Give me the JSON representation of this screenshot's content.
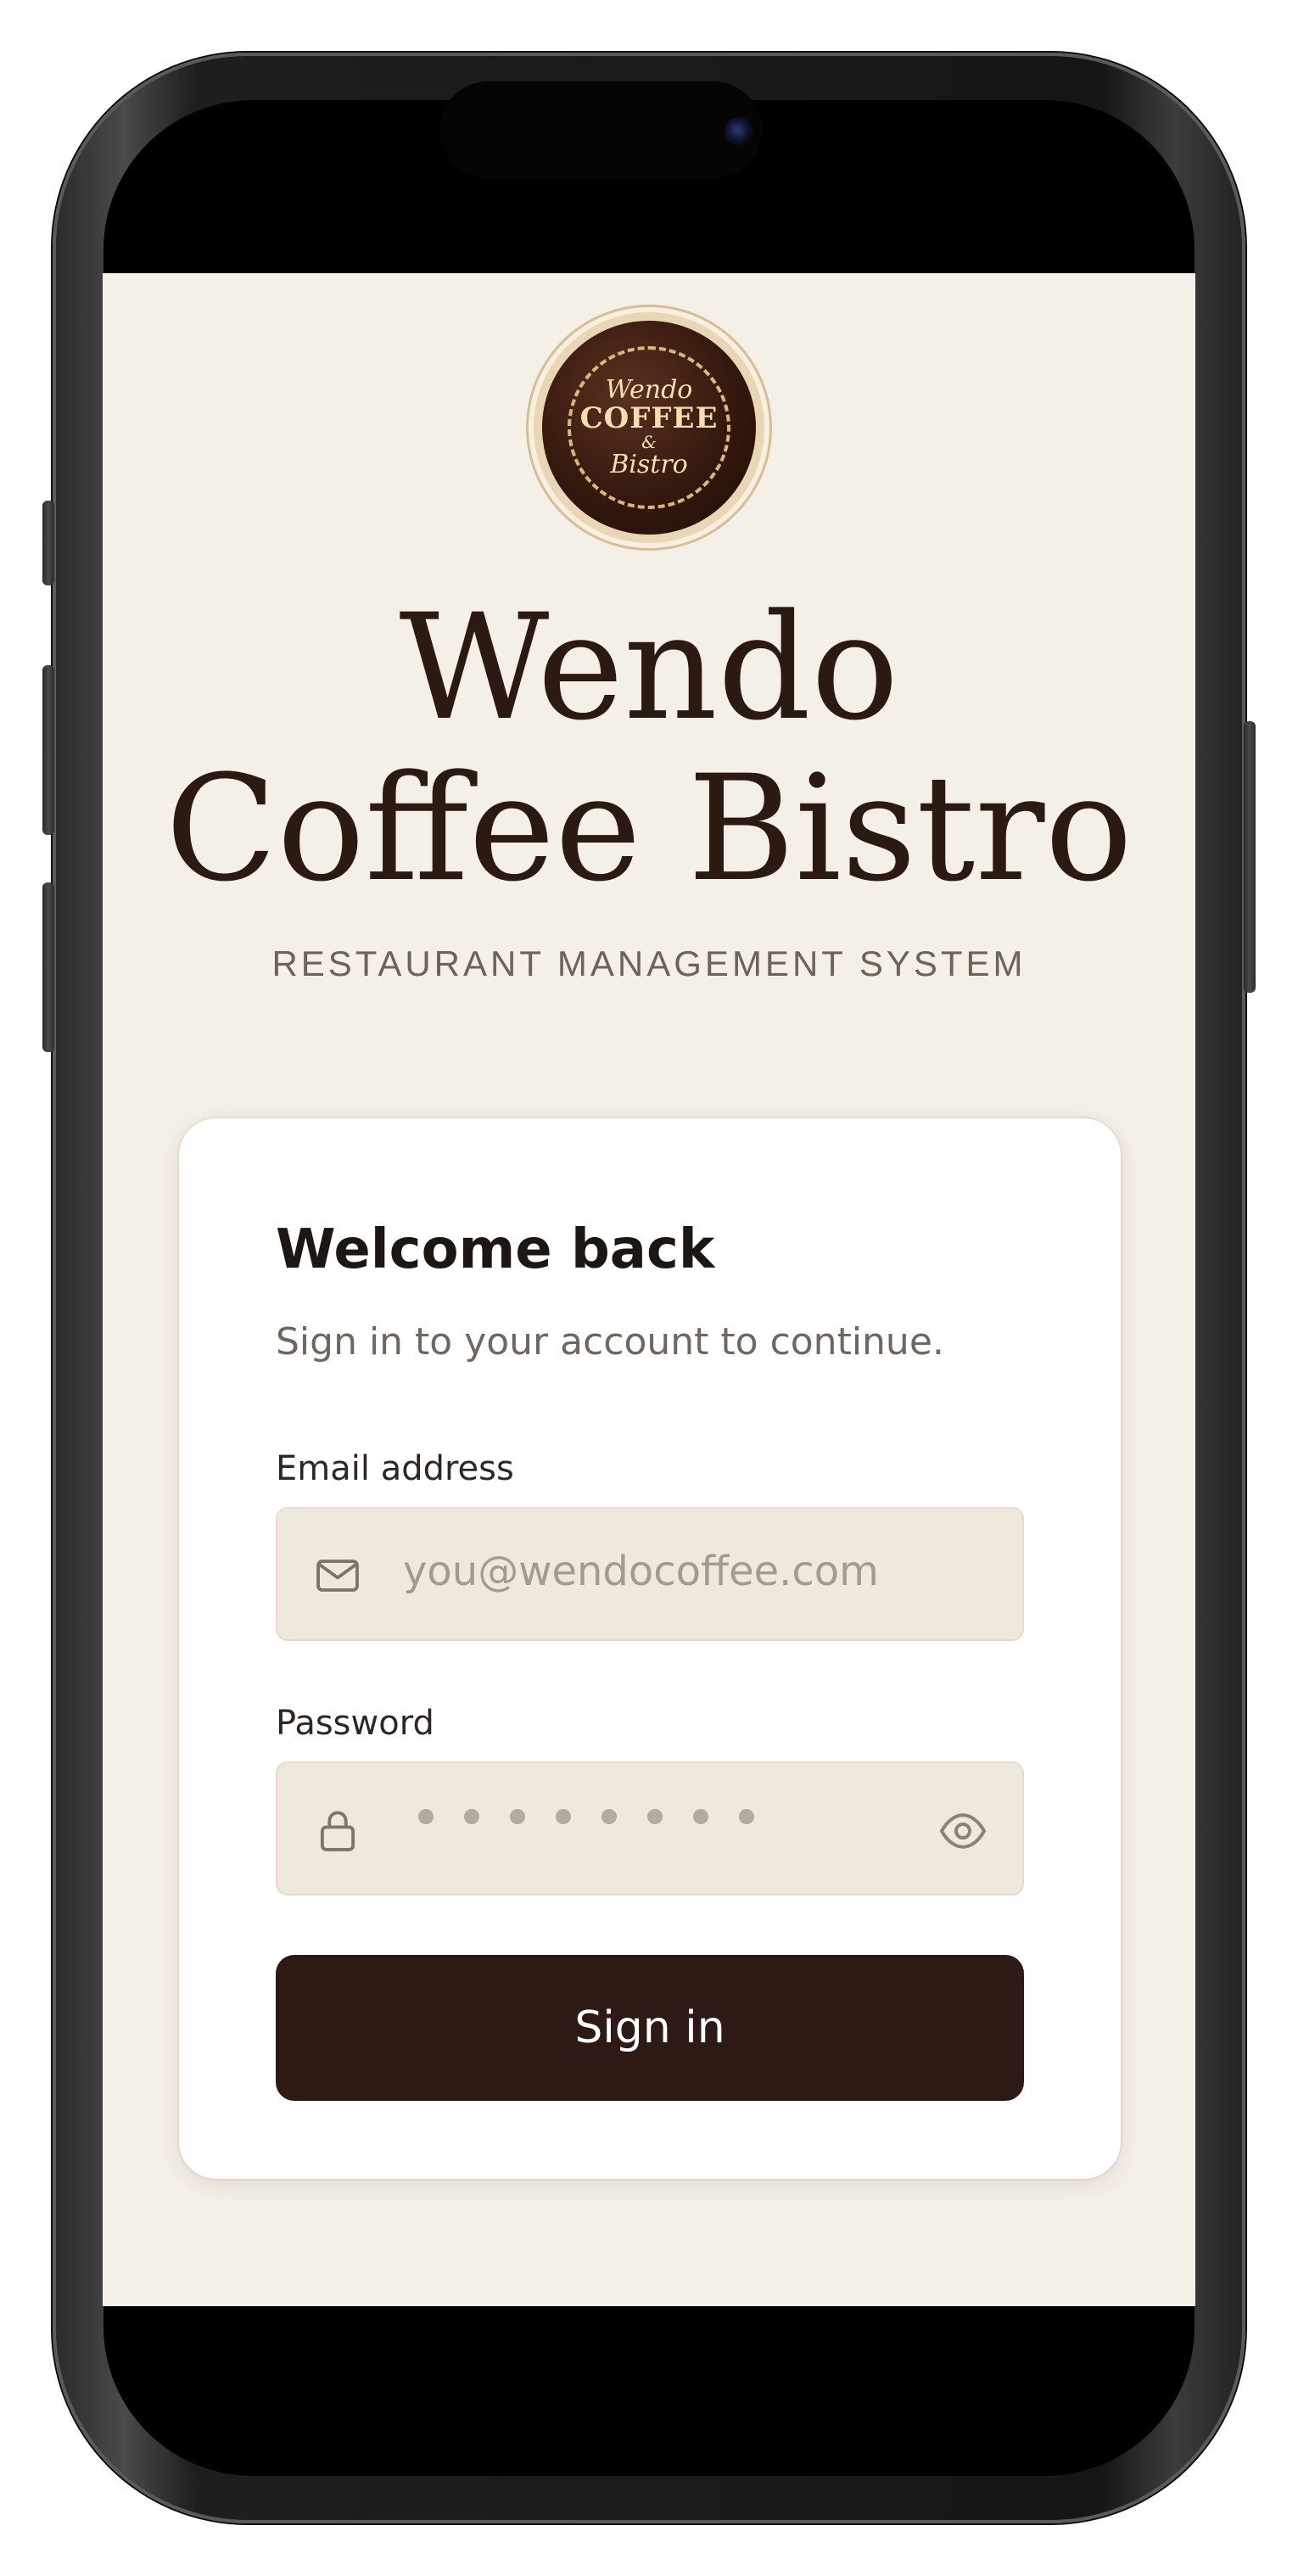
{
  "logo": {
    "line1": "Wendo",
    "line2": "COFFEE",
    "line3": "&",
    "line4": "Bistro"
  },
  "brand": {
    "title_line1": "Wendo",
    "title_line2": "Coffee Bistro",
    "subtitle": "RESTAURANT MANAGEMENT SYSTEM"
  },
  "login": {
    "heading": "Welcome back",
    "subheading": "Sign in to your account to continue.",
    "email": {
      "label": "Email address",
      "placeholder": "you@wendocoffee.com",
      "icon": "mail-icon"
    },
    "password": {
      "label": "Password",
      "icon": "lock-icon",
      "toggle_icon": "eye-icon"
    },
    "submit_label": "Sign in"
  },
  "colors": {
    "background": "#f4efe7",
    "primary": "#2e1a14",
    "field": "#efe8dc",
    "card": "#ffffff"
  }
}
